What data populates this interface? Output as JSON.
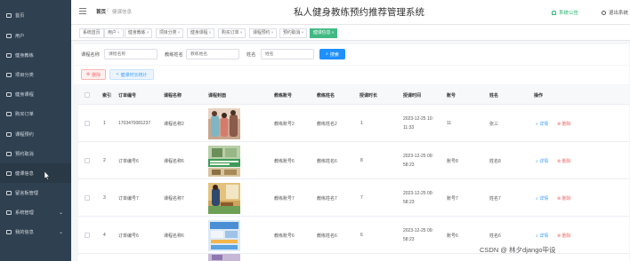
{
  "sidebar": {
    "items": [
      {
        "label": "首页",
        "icon": "home-icon"
      },
      {
        "label": "用户",
        "icon": "user-icon"
      },
      {
        "label": "健身教练",
        "icon": "coach-icon"
      },
      {
        "label": "项目分类",
        "icon": "category-icon"
      },
      {
        "label": "健身课程",
        "icon": "course-icon"
      },
      {
        "label": "购买订单",
        "icon": "order-icon"
      },
      {
        "label": "课程预约",
        "icon": "booking-icon"
      },
      {
        "label": "预约取消",
        "icon": "cancel-icon"
      },
      {
        "label": "健课信息",
        "icon": "info-icon"
      },
      {
        "label": "留言板管理",
        "icon": "message-icon"
      },
      {
        "label": "系统管理",
        "icon": "settings-icon"
      },
      {
        "label": "我的信息",
        "icon": "profile-icon"
      }
    ]
  },
  "header": {
    "breadcrumb_home": "首页",
    "breadcrumb_sep": "/",
    "breadcrumb_current": "健课信息",
    "title": "私人健身教练预约推荐管理系统",
    "notice": "系统公告",
    "logout": "退出系统"
  },
  "tabs": [
    {
      "label": "系统首页",
      "close": ""
    },
    {
      "label": "用户",
      "close": "×"
    },
    {
      "label": "健身教练",
      "close": "×"
    },
    {
      "label": "项目分类",
      "close": "×"
    },
    {
      "label": "健身课程",
      "close": "×"
    },
    {
      "label": "购买订单",
      "close": "×"
    },
    {
      "label": "课程预约",
      "close": "×"
    },
    {
      "label": "预约取消",
      "close": "×"
    },
    {
      "label": "健课信息",
      "close": "×"
    }
  ],
  "search": {
    "course_name_label": "课程名称",
    "course_name_placeholder": "课程名称",
    "coach_name_label": "教练姓名",
    "coach_name_placeholder": "教练姓名",
    "name_label": "姓名",
    "name_placeholder": "姓名",
    "button": "搜索"
  },
  "actions": {
    "delete": "删除",
    "stats": "健课时长统计"
  },
  "table": {
    "headers": [
      "索引",
      "订单编号",
      "课程名称",
      "课程封面",
      "教练账号",
      "教练姓名",
      "授课时长",
      "授课时间",
      "账号",
      "姓名",
      "操作"
    ],
    "rows": [
      {
        "index": "1",
        "order_no": "1703470081237",
        "course": "课程名称2",
        "coach_account": "教练账号2",
        "coach_name": "教练姓名2",
        "duration": "1",
        "time_a": "2023-12-25 10:",
        "time_b": "11:33",
        "account": "11",
        "name": "张三"
      },
      {
        "index": "2",
        "order_no": "订单编号6",
        "course": "课程名称6",
        "coach_account": "教练账号6",
        "coach_name": "教练姓名6",
        "duration": "8",
        "time_a": "2023-12-25 09:",
        "time_b": "58:23",
        "account": "账号8",
        "name": "姓名8"
      },
      {
        "index": "3",
        "order_no": "订单编号7",
        "course": "课程名称7",
        "coach_account": "教练账号7",
        "coach_name": "教练姓名7",
        "duration": "7",
        "time_a": "2023-12-25 09:",
        "time_b": "58:23",
        "account": "账号7",
        "name": "姓名7"
      },
      {
        "index": "4",
        "order_no": "订单编号6",
        "course": "课程名称6",
        "coach_account": "教练账号6",
        "coach_name": "教练姓名6",
        "duration": "6",
        "time_a": "2023-12-25 09:",
        "time_b": "58:23",
        "account": "账号6",
        "name": "姓名6"
      }
    ],
    "detail_label": "详情",
    "delete_label": "删除"
  },
  "watermark": "CSDN @ 林夕django毕设",
  "colors": {
    "sidebar_bg": "#2f4050",
    "accent_green": "#42b983",
    "primary_blue": "#1e90ff",
    "danger_red": "#f56c6c"
  }
}
